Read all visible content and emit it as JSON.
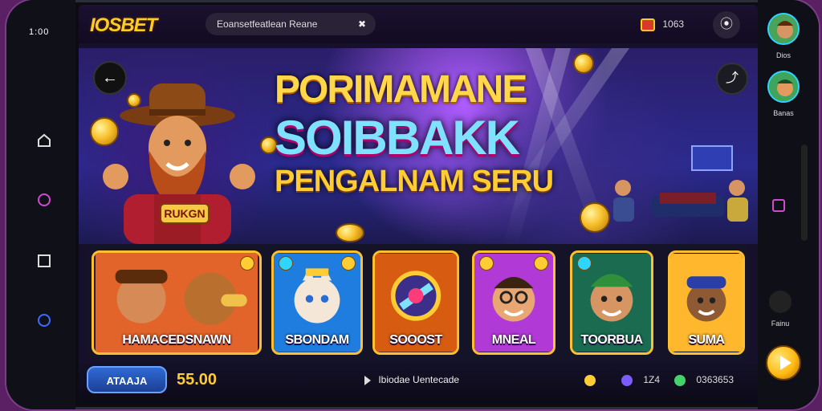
{
  "status_bar": {
    "time": "1:00"
  },
  "app": {
    "logo": "IOSBET",
    "search_placeholder": "Eoansetfeatlean Reane",
    "balance": "1063"
  },
  "banner": {
    "headline_1": "PORIMAMANE",
    "headline_2": "SOIBBAKK",
    "headline_3": "PENGALNAM SERU",
    "badge_text": "RUKGN"
  },
  "games": [
    {
      "label": "HAMACEDSNAWN"
    },
    {
      "label": "SBONDAM"
    },
    {
      "label": "SOOOST"
    },
    {
      "label": "MNEAL"
    },
    {
      "label": "TOORBUA"
    },
    {
      "label": "SUMA"
    }
  ],
  "bottom_bar": {
    "button_label": "ATAAJA",
    "amount": "55.00",
    "center_text": "Ibiodae Uentecade",
    "stat_2": "1Z4",
    "stat_3": "0363653"
  },
  "right_rail": {
    "avatar_1_label": "Dios",
    "avatar_2_label": "Banas",
    "cam_label": "Fainu"
  },
  "colors": {
    "accent": "#ffcc33",
    "primary_blue": "#2f6ad6",
    "background": "#17102a"
  }
}
